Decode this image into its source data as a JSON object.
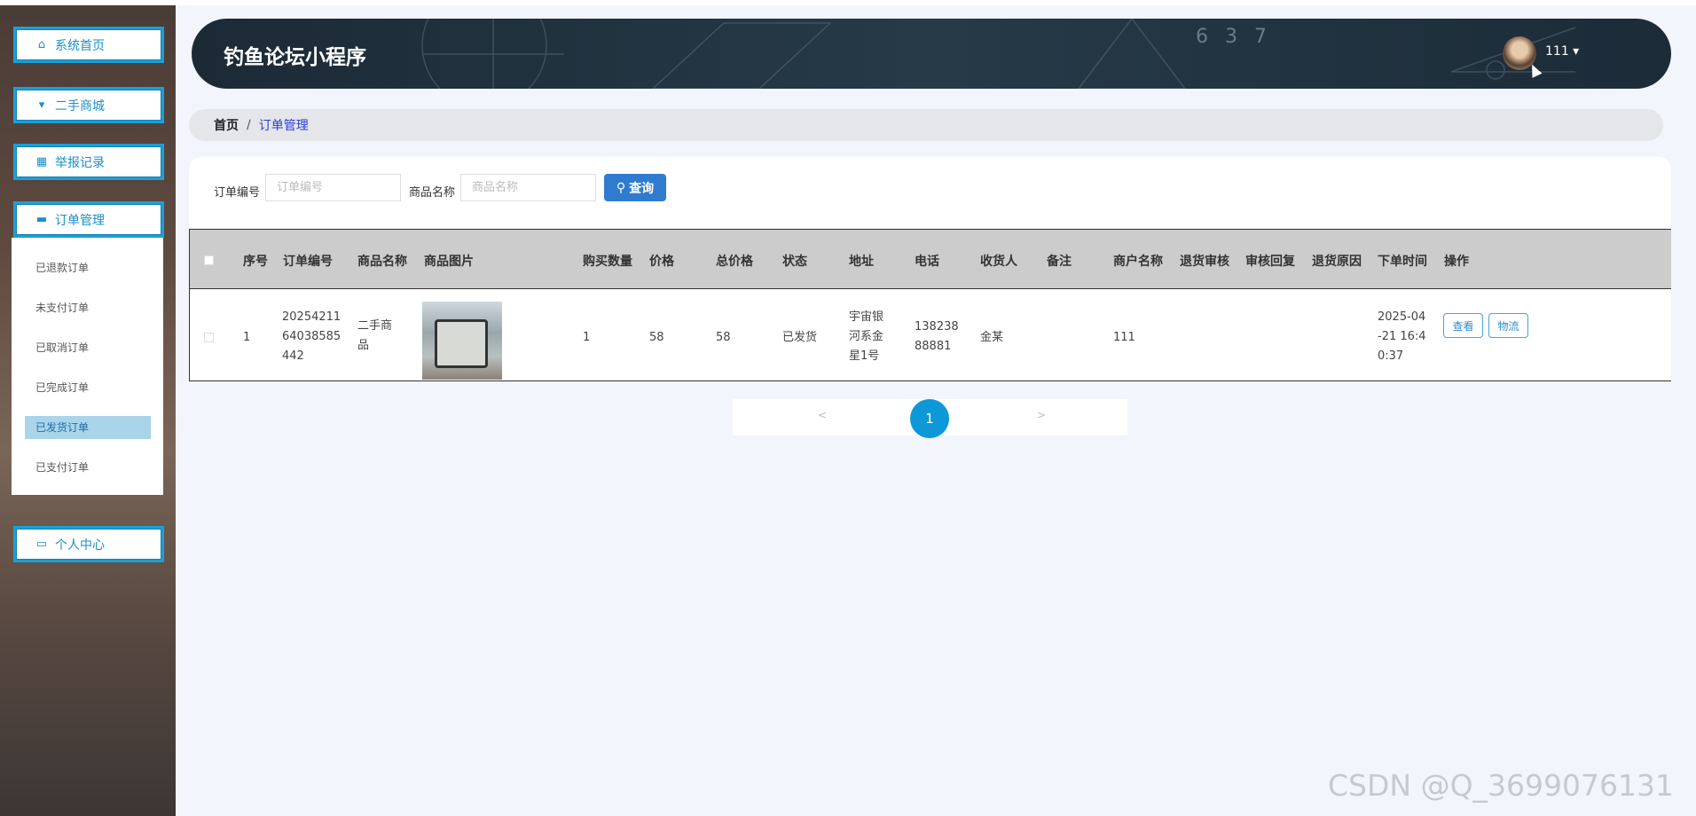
{
  "sidebar": {
    "items": [
      {
        "label": "系统首页",
        "icon": "home-icon"
      },
      {
        "label": "二手商城",
        "icon": "brush-icon"
      },
      {
        "label": "举报记录",
        "icon": "grid-icon"
      },
      {
        "label": "订单管理",
        "icon": "monitor-icon"
      },
      {
        "label": "个人中心",
        "icon": "card-icon"
      }
    ],
    "submenu": [
      "已退款订单",
      "未支付订单",
      "已取消订单",
      "已完成订单",
      "已发货订单",
      "已支付订单"
    ],
    "active_sub": "已发货订单"
  },
  "header": {
    "title": "钓鱼论坛小程序",
    "user": "111 ▾",
    "decor": "6 3 7"
  },
  "breadcrumb": {
    "home": "首页",
    "sep": "/",
    "current": "订单管理"
  },
  "search": {
    "order_no_label": "订单编号",
    "order_no_placeholder": "订单编号",
    "product_label": "商品名称",
    "product_placeholder": "商品名称",
    "query_button": "查询"
  },
  "table": {
    "headers": [
      "序号",
      "订单编号",
      "商品名称",
      "商品图片",
      "购买数量",
      "价格",
      "总价格",
      "状态",
      "地址",
      "电话",
      "收货人",
      "备注",
      "商户名称",
      "退货审核",
      "审核回复",
      "退货原因",
      "下单时间",
      "操作"
    ],
    "rows": [
      {
        "index": "1",
        "order_no": [
          "20254211",
          "64038585",
          "442"
        ],
        "product": [
          "二手商",
          "品"
        ],
        "qty": "1",
        "price": "58",
        "total": "58",
        "status": "已发货",
        "address": [
          "宇宙银",
          "河系金",
          "星1号"
        ],
        "phone": [
          "138238",
          "88881"
        ],
        "receiver": "金某",
        "remark": "",
        "merchant": "111",
        "return_review": "",
        "review_reply": "",
        "return_reason": "",
        "time": [
          "2025-04",
          "-21 16:4",
          "0:37"
        ],
        "actions": [
          "查看",
          "物流"
        ]
      }
    ]
  },
  "pagination": {
    "prev": "<",
    "current": "1",
    "next": ">"
  },
  "watermark": "CSDN @Q_3699076131",
  "colors": {
    "accent": "#1aa0d8",
    "primary_button": "#2f7bd0",
    "page_current": "#0d98d8",
    "header_bg": "#1c2a36"
  }
}
